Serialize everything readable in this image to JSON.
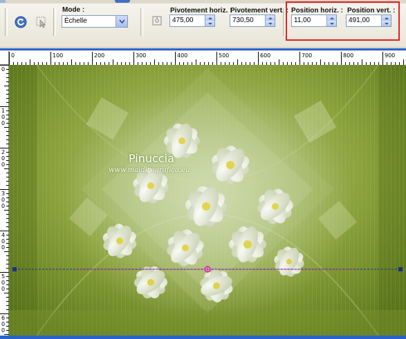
{
  "toolbar": {
    "mode_label": "Mode :",
    "mode_value": "Échelle",
    "pivot_h_label": "Pivotement horiz. :",
    "pivot_h_value": "475,00",
    "pivot_v_label": "Pivotement vert. :",
    "pivot_v_value": "730,50",
    "pos_h_label": "Position horiz. :",
    "pos_h_value": "11,00",
    "pos_v_label": "Position vert. :",
    "pos_v_value": "491,00"
  },
  "ruler": {
    "h_labels": [
      "0",
      "100",
      "200",
      "300",
      "400",
      "500",
      "600",
      "700",
      "800",
      "900"
    ],
    "v_labels": [
      "0",
      "1\n0\n0",
      "2\n0\n0",
      "3\n0\n0",
      "4\n0\n0",
      "5\n0\n0",
      "6\n0\n0"
    ]
  },
  "watermark": {
    "name": "Pinuccia",
    "url": "www.maidiregrafica.eu"
  },
  "colors": {
    "canvas_dark": "#5e7a1e",
    "canvas_light": "#9cb54a",
    "highlight": "#e61e1e",
    "ruler_blue": "#2a63c9",
    "guide_magenta": "#e020c0"
  },
  "icons": [
    "reset-icon",
    "select-tool-icon",
    "pivot-icon",
    "chevron-down-icon"
  ]
}
